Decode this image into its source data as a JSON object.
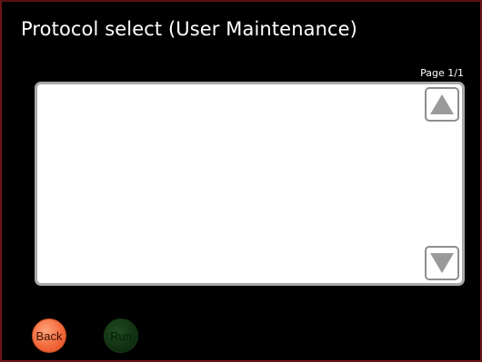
{
  "window": {
    "title": "Protocol select (User Maintenance)"
  },
  "list": {
    "page_indicator": "Page 1/1",
    "items": []
  },
  "buttons": {
    "back_label": "Back",
    "run_label": "Run"
  },
  "colors": {
    "background": "#000000",
    "frame_border": "#6b1616",
    "list_border": "#a9a9a9",
    "back_button": "#f26a3c",
    "run_button": "#123212",
    "scroll_arrow": "#9a9a9a"
  },
  "icons": {
    "scroll_up": "triangle-up-icon",
    "scroll_down": "triangle-down-icon"
  }
}
